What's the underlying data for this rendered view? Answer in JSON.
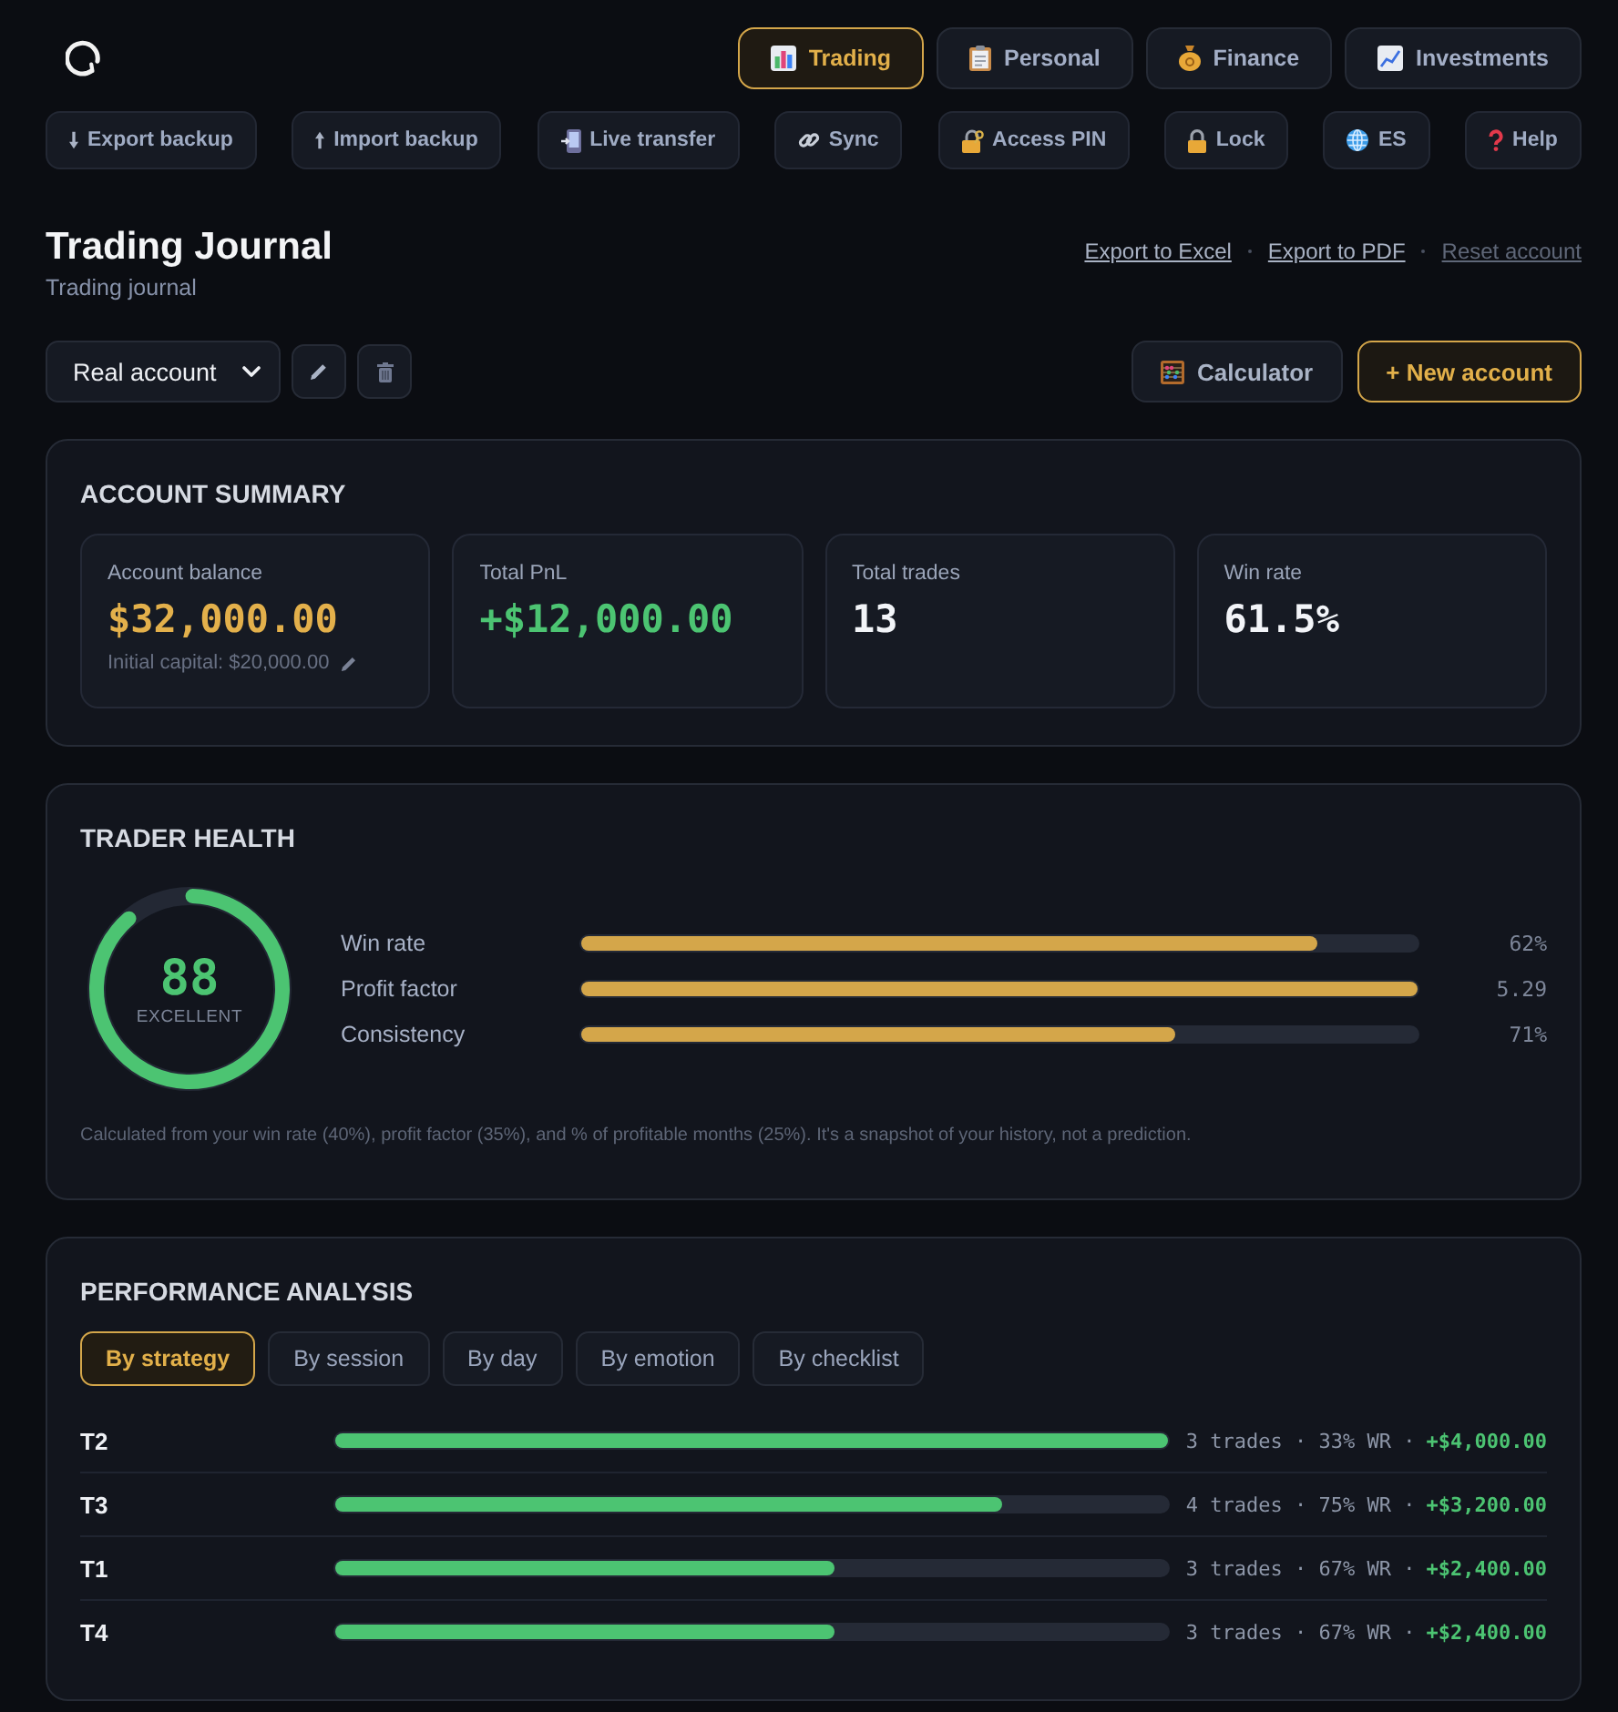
{
  "app": {
    "nav_tabs": [
      {
        "label": "Trading",
        "selected": true
      },
      {
        "label": "Personal",
        "selected": false
      },
      {
        "label": "Finance",
        "selected": false
      },
      {
        "label": "Investments",
        "selected": false
      }
    ],
    "toolbar": [
      "Export backup",
      "Import backup",
      "Live transfer",
      "Sync",
      "Access PIN",
      "Lock",
      "ES",
      "Help"
    ]
  },
  "page": {
    "title": "Trading Journal",
    "subtitle": "Trading journal",
    "links": [
      {
        "label": "Export to Excel",
        "dimmed": false
      },
      {
        "label": "Export to PDF",
        "dimmed": false
      },
      {
        "label": "Reset account",
        "dimmed": true
      }
    ],
    "account_select": {
      "value": "Real account"
    },
    "buttons": [
      {
        "label": "Calculator",
        "primary": false
      },
      {
        "label": "+ New account",
        "primary": true
      }
    ]
  },
  "account_summary": {
    "title": "ACCOUNT SUMMARY",
    "stats": [
      {
        "label": "Account balance",
        "value": "$32,000.00",
        "color": "#e3b04b",
        "note": "Initial capital: $20,000.00"
      },
      {
        "label": "Total PnL",
        "value": "+$12,000.00",
        "color": "#4cc472"
      },
      {
        "label": "Total trades",
        "value": "13",
        "color": "#f2f4f8"
      },
      {
        "label": "Win rate",
        "value": "61.5%",
        "color": "#f2f4f8"
      }
    ]
  },
  "trader_health": {
    "title": "TRADER HEALTH",
    "score": {
      "value": "88",
      "rating": "EXCELLENT",
      "level": 0.88
    },
    "metrics": [
      {
        "name": "Win rate",
        "level": 0.88,
        "reading": "62%"
      },
      {
        "name": "Profit factor",
        "level": 1,
        "reading": "5.29"
      },
      {
        "name": "Consistency",
        "level": 0.71,
        "reading": "71%"
      }
    ],
    "note": "Calculated from your win rate (40%), profit factor (35%), and % of profitable months (25%). It's a snapshot of your history, not a prediction."
  },
  "performance_analysis": {
    "title": "PERFORMANCE ANALYSIS",
    "tabs": [
      {
        "label": "By strategy",
        "selected": true
      },
      {
        "label": "By session",
        "selected": false
      },
      {
        "label": "By day",
        "selected": false
      },
      {
        "label": "By emotion",
        "selected": false
      },
      {
        "label": "By checklist",
        "selected": false
      }
    ],
    "rows": [
      {
        "name": "T2",
        "level": 1,
        "stats": "3 trades · 33% WR ·",
        "pnl": "+$4,000.00"
      },
      {
        "name": "T3",
        "level": 0.8,
        "stats": "4 trades · 75% WR ·",
        "pnl": "+$3,200.00"
      },
      {
        "name": "T1",
        "level": 0.6,
        "stats": "3 trades · 67% WR ·",
        "pnl": "+$2,400.00"
      },
      {
        "name": "T4",
        "level": 0.6,
        "stats": "3 trades · 67% WR ·",
        "pnl": "+$2,400.00"
      }
    ]
  }
}
